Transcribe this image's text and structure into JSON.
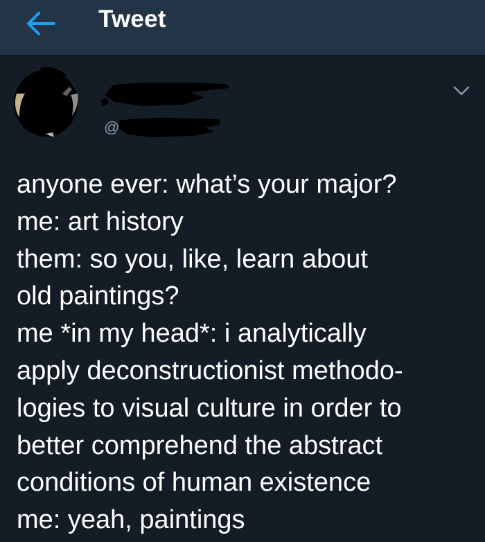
{
  "header": {
    "title": "Tweet",
    "back_icon": "arrow-left-icon",
    "accent": "#1da1f2",
    "bar_color": "#243447"
  },
  "tweet": {
    "handle_prefix": "@",
    "menu_icon": "chevron-down-icon",
    "lines": [
      "anyone ever: what’s your major?",
      "me: art history",
      "them: so you, like, learn about",
      "old paintings?",
      "me *in my head*: i analytically",
      "apply deconstructionist methodo-",
      "logies to visual culture in order to",
      "better comprehend the abstract",
      "conditions of human existence",
      "me: yeah, paintings"
    ]
  },
  "colors": {
    "background": "#141d26",
    "text": "#ffffff",
    "secondary_text": "#8899a6"
  }
}
